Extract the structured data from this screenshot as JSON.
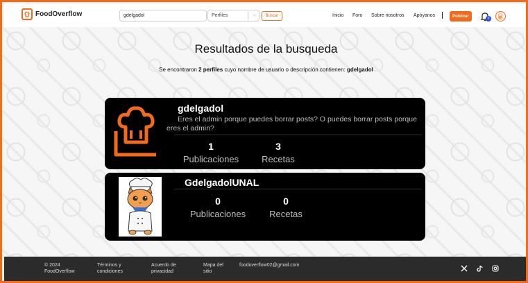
{
  "header": {
    "logo_text": "FoodOverflow",
    "search_value": "gdelgadol",
    "filter_selected": "Perfiles",
    "search_button": "Buscar",
    "nav": [
      "Inicio",
      "Foro",
      "Sobre nosotros",
      "Apóyanos"
    ],
    "publish_button": "Publicar",
    "notification_count": "0"
  },
  "main": {
    "title": "Resultados de la busqueda",
    "summary_prefix": "Se encontraron ",
    "summary_count": "2 perfiles",
    "summary_middle": " cuyo nombre de usuario o descripción contienen: ",
    "summary_query": "gdelgadol",
    "profiles": [
      {
        "username": "gdelgadol",
        "description": "Eres el admin porque puedes borrar posts? O puedes borrar posts porque eres el admin?",
        "posts_count": "1",
        "posts_label": "Publicaciones",
        "recipes_count": "3",
        "recipes_label": "Recetas"
      },
      {
        "username": "GdelgadolUNAL",
        "description": "",
        "posts_count": "0",
        "posts_label": "Publicaciones",
        "recipes_count": "0",
        "recipes_label": "Recetas"
      }
    ]
  },
  "footer": {
    "copyright": [
      "© 2024",
      "FoodOverflow"
    ],
    "terms": [
      "Términos y",
      "condiciones"
    ],
    "privacy": [
      "Acuerdo de",
      "privacidad"
    ],
    "sitemap": [
      "Mapa del",
      "sitio"
    ],
    "email": "foodoverflow02@gmail.com"
  },
  "colors": {
    "accent": "#f26a1b",
    "card_bg": "#000000",
    "footer_bg": "#2b2b2b"
  },
  "icons": [
    "chef-hat-icon",
    "bell-icon",
    "x-icon",
    "tiktok-icon",
    "instagram-icon"
  ]
}
